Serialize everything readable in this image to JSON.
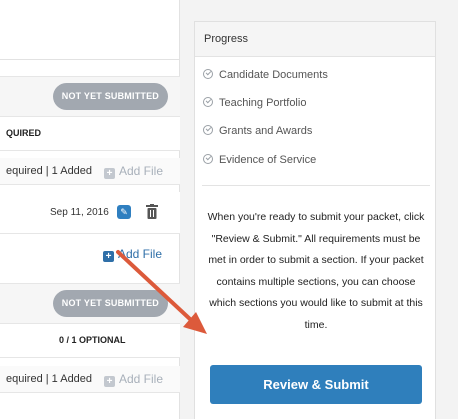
{
  "left": {
    "section1": {
      "status": "NOT YET SUBMITTED",
      "requirement": "QUIRED",
      "summary": "equired  |  1 Added",
      "add_file": "Add File"
    },
    "file": {
      "date": "Sep 11, 2016",
      "add_file": "Add File"
    },
    "section2": {
      "status": "NOT YET SUBMITTED",
      "requirement": "0 / 1 OPTIONAL",
      "summary": "equired  |  1 Added",
      "add_file": "Add File"
    }
  },
  "progress": {
    "title": "Progress",
    "items": [
      {
        "label": "Candidate Documents"
      },
      {
        "label": "Teaching Portfolio"
      },
      {
        "label": "Grants and Awards"
      },
      {
        "label": "Evidence of Service"
      }
    ],
    "info_lines": [
      "When you're ready to submit your packet, click",
      "\"Review & Submit.\" All requirements must be",
      "met in order to submit a section. If your packet",
      "contains multiple sections, you can choose",
      "which sections you would like to submit at this",
      "time."
    ],
    "submit_label": "Review & Submit"
  },
  "colors": {
    "accent": "#2f7fbc",
    "pill": "#a2a8b0",
    "arrow": "#dc5a3b"
  }
}
